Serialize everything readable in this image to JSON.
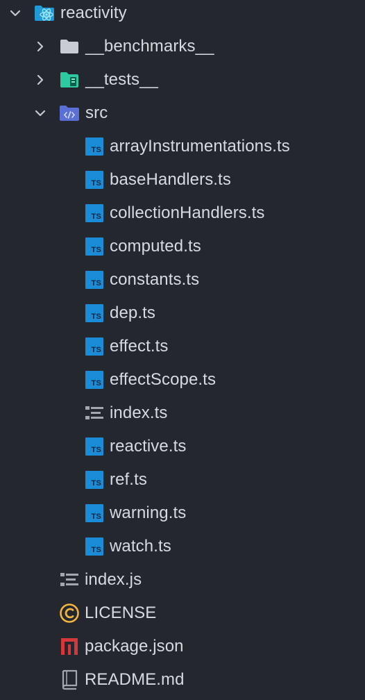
{
  "explorer": {
    "root": {
      "label": "reactivity",
      "icon": "react-folder-icon",
      "expanded": true,
      "accent": "#3fb6e6"
    },
    "folders": [
      {
        "label": "__benchmarks__",
        "icon": "folder-icon",
        "expanded": false
      },
      {
        "label": "__tests__",
        "icon": "test-folder-icon",
        "expanded": false
      },
      {
        "label": "src",
        "icon": "src-folder-icon",
        "expanded": true
      }
    ],
    "src_files": [
      {
        "label": "arrayInstrumentations.ts",
        "icon": "typescript-icon"
      },
      {
        "label": "baseHandlers.ts",
        "icon": "typescript-icon"
      },
      {
        "label": "collectionHandlers.ts",
        "icon": "typescript-icon"
      },
      {
        "label": "computed.ts",
        "icon": "typescript-icon"
      },
      {
        "label": "constants.ts",
        "icon": "typescript-icon"
      },
      {
        "label": "dep.ts",
        "icon": "typescript-icon"
      },
      {
        "label": "effect.ts",
        "icon": "typescript-icon"
      },
      {
        "label": "effectScope.ts",
        "icon": "typescript-icon"
      },
      {
        "label": "index.ts",
        "icon": "index-list-icon"
      },
      {
        "label": "reactive.ts",
        "icon": "typescript-icon"
      },
      {
        "label": "ref.ts",
        "icon": "typescript-icon"
      },
      {
        "label": "warning.ts",
        "icon": "typescript-icon"
      },
      {
        "label": "watch.ts",
        "icon": "typescript-icon"
      }
    ],
    "root_files": [
      {
        "label": "index.js",
        "icon": "index-list-icon"
      },
      {
        "label": "LICENSE",
        "icon": "license-icon"
      },
      {
        "label": "package.json",
        "icon": "npm-package-icon"
      },
      {
        "label": "README.md",
        "icon": "readme-book-icon"
      }
    ],
    "ts_badge": "TS",
    "colors": {
      "background": "#24272e",
      "text": "#d7dae0",
      "typescript": "#1a8cd8",
      "tests_folder": "#2ec9a0",
      "src_folder": "#5b6fd6",
      "license": "#f0b440",
      "npm": "#d6373b",
      "muted_icon": "#a3a7b0"
    }
  }
}
